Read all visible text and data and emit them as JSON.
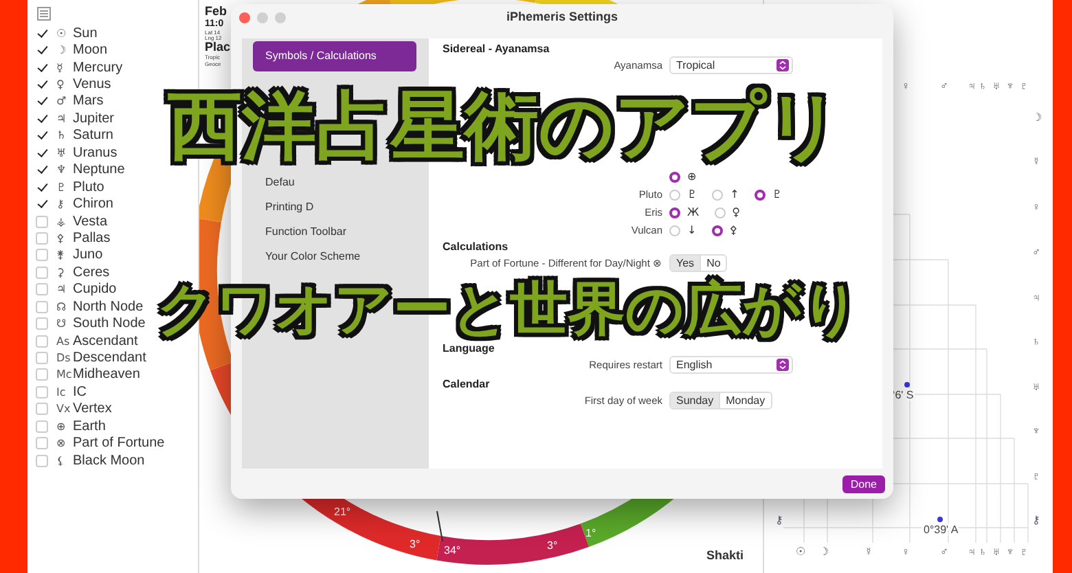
{
  "sidebar": {
    "items": [
      {
        "glyph": "☉",
        "label": "Sun",
        "checked": true
      },
      {
        "glyph": "☽",
        "label": "Moon",
        "checked": true
      },
      {
        "glyph": "☿",
        "label": "Mercury",
        "checked": true
      },
      {
        "glyph": "♀",
        "label": "Venus",
        "checked": true
      },
      {
        "glyph": "♂",
        "label": "Mars",
        "checked": true
      },
      {
        "glyph": "♃",
        "label": "Jupiter",
        "checked": true
      },
      {
        "glyph": "♄",
        "label": "Saturn",
        "checked": true
      },
      {
        "glyph": "♅",
        "label": "Uranus",
        "checked": true
      },
      {
        "glyph": "♆",
        "label": "Neptune",
        "checked": true
      },
      {
        "glyph": "♇",
        "label": "Pluto",
        "checked": true
      },
      {
        "glyph": "⚷",
        "label": "Chiron",
        "checked": true
      },
      {
        "glyph": "⚶",
        "label": "Vesta",
        "checked": false
      },
      {
        "glyph": "⚴",
        "label": "Pallas",
        "checked": false
      },
      {
        "glyph": "⚵",
        "label": "Juno",
        "checked": false
      },
      {
        "glyph": "⚳",
        "label": "Ceres",
        "checked": false
      },
      {
        "glyph": "♃",
        "label": "Cupido",
        "checked": false
      },
      {
        "glyph": "☊",
        "label": "North Node",
        "checked": false
      },
      {
        "glyph": "☋",
        "label": "South Node",
        "checked": false
      },
      {
        "glyph": "As",
        "label": "Ascendant",
        "checked": false
      },
      {
        "glyph": "Ds",
        "label": "Descendant",
        "checked": false
      },
      {
        "glyph": "Mc",
        "label": "Midheaven",
        "checked": false
      },
      {
        "glyph": "Ic",
        "label": "IC",
        "checked": false
      },
      {
        "glyph": "Vx",
        "label": "Vertex",
        "checked": false
      },
      {
        "glyph": "⊕",
        "label": "Earth",
        "checked": false
      },
      {
        "glyph": "⊗",
        "label": "Part of Fortune",
        "checked": false
      },
      {
        "glyph": "⚸",
        "label": "Black Moon",
        "checked": false
      }
    ]
  },
  "chart": {
    "info": [
      {
        "text": "Feb",
        "kind": "title"
      },
      {
        "text": "11:0",
        "kind": "time"
      },
      {
        "text": "Lat 14",
        "kind": "small"
      },
      {
        "text": "Lng 12",
        "kind": "small"
      },
      {
        "text": "Plac",
        "kind": "title"
      },
      {
        "text": "Tropic",
        "kind": "small"
      },
      {
        "text": "Geoce",
        "kind": "small"
      }
    ],
    "wheel_labels": [
      "21°",
      "3°",
      "34°",
      "3°",
      "1°"
    ],
    "caption": "Shakti"
  },
  "aspect_grid": {
    "top_glyphs": [
      "♀",
      "♂",
      "♃",
      "♄",
      "♅",
      "♆",
      "♇"
    ],
    "side_glyphs": [
      "☽",
      "☿",
      "♀",
      "♂",
      "♃",
      "♄",
      "♅",
      "♆",
      "♇",
      "⚷"
    ],
    "bottom_glyphs": [
      "☉",
      "☽",
      "☿",
      "♀",
      "♂",
      "♃",
      "♄",
      "♅",
      "♆",
      "♇"
    ],
    "corner_glyph": "⚷",
    "readings": [
      "°6' S",
      "0°39' A"
    ]
  },
  "dialog": {
    "title": "iPhemeris Settings",
    "nav": [
      {
        "label": "Symbols / Calculations",
        "selected": true
      },
      {
        "label": "Defau",
        "selected": false
      },
      {
        "label": "Printing D",
        "selected": false
      },
      {
        "label": "Function Toolbar",
        "selected": false
      },
      {
        "label": "Your Color Scheme",
        "selected": false
      }
    ],
    "sections": [
      {
        "title": "Sidereal - Ayanamsa",
        "rows": [
          {
            "kind": "select",
            "label": "Ayanamsa",
            "value": "Tropical"
          },
          {
            "kind": "radio",
            "options": [
              {
                "glyph": "⊕",
                "selected": true
              }
            ]
          },
          {
            "kind": "radio",
            "label": "Pluto",
            "options": [
              {
                "glyph": "♇",
                "selected": false
              },
              {
                "glyph": "↑",
                "selected": false
              },
              {
                "glyph": "♇",
                "selected": true
              }
            ]
          },
          {
            "kind": "radio",
            "label": "Eris",
            "options": [
              {
                "glyph": "Ж",
                "selected": true
              },
              {
                "glyph": "♀",
                "selected": false
              }
            ]
          },
          {
            "kind": "radio",
            "label": "Vulcan",
            "options": [
              {
                "glyph": "↓",
                "selected": false
              },
              {
                "glyph": "⚴",
                "selected": true
              }
            ]
          }
        ]
      },
      {
        "title": "Calculations",
        "rows": [
          {
            "kind": "segmented",
            "label": "Part of Fortune - Different for Day/Night ⊗",
            "options": [
              {
                "label": "Yes",
                "selected": true
              },
              {
                "label": "No",
                "selected": false
              }
            ]
          }
        ]
      },
      {
        "title": "Language",
        "rows": [
          {
            "kind": "select",
            "label": "Requires restart",
            "value": "English"
          }
        ]
      },
      {
        "title": "Calendar",
        "rows": [
          {
            "kind": "segmented",
            "label": "First day of week",
            "options": [
              {
                "label": "Sunday",
                "selected": true
              },
              {
                "label": "Monday",
                "selected": false
              }
            ]
          }
        ]
      }
    ],
    "done": "Done"
  },
  "overlay": {
    "lines": [
      "西洋占星術のアプリ",
      "クワオアーと世界の広がり"
    ]
  }
}
